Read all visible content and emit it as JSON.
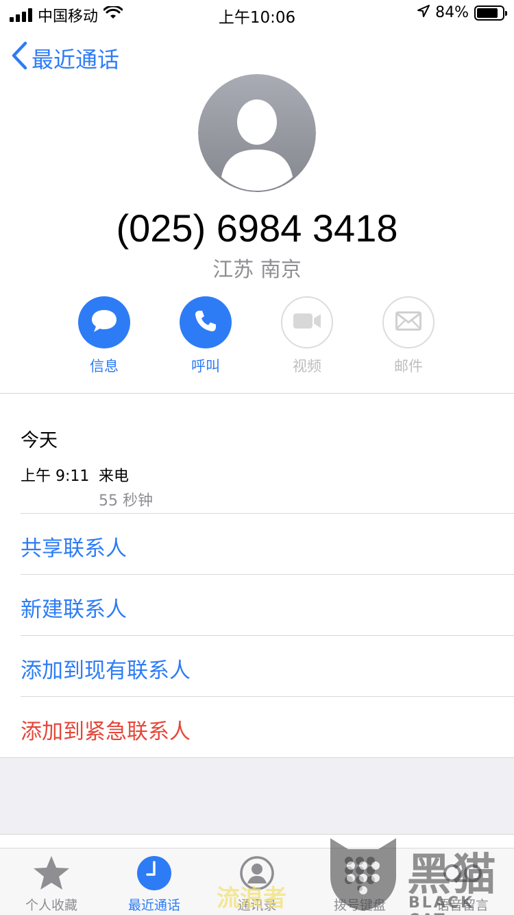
{
  "status_bar": {
    "carrier": "中国移动",
    "time": "上午10:06",
    "battery_percent": "84%",
    "battery_level": 0.84
  },
  "nav": {
    "back_label": "最近通话"
  },
  "contact": {
    "phone_number": "(025) 6984 3418",
    "location": "江苏 南京"
  },
  "actions": [
    {
      "label": "信息",
      "icon": "message-icon",
      "enabled": true
    },
    {
      "label": "呼叫",
      "icon": "phone-icon",
      "enabled": true
    },
    {
      "label": "视频",
      "icon": "video-icon",
      "enabled": false
    },
    {
      "label": "邮件",
      "icon": "mail-icon",
      "enabled": false
    }
  ],
  "history": {
    "date": "今天",
    "time": "上午 9:11",
    "type": "来电",
    "duration": "55 秒钟"
  },
  "options": [
    {
      "label": "共享联系人"
    },
    {
      "label": "新建联系人"
    },
    {
      "label": "添加到现有联系人"
    },
    {
      "label": "添加到紧急联系人"
    }
  ],
  "tabs": [
    {
      "label": "个人收藏",
      "icon": "star-icon"
    },
    {
      "label": "最近通话",
      "icon": "clock-icon",
      "active": true
    },
    {
      "label": "通讯录",
      "icon": "contacts-icon"
    },
    {
      "label": "拨号键盘",
      "icon": "keypad-icon"
    },
    {
      "label": "语音留言",
      "icon": "voicemail-icon"
    }
  ],
  "watermarks": {
    "left": "流浪者",
    "brand_cn": "黑猫",
    "brand_en": "BLACK CAT"
  },
  "colors": {
    "accent": "#2d7cf6",
    "danger": "#e5473a",
    "secondary": "#8e8e93"
  }
}
